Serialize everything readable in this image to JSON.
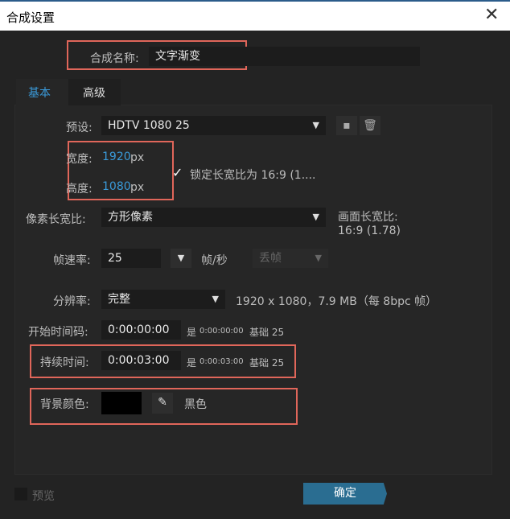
{
  "window": {
    "title": "合成设置",
    "close_icon": "close-icon"
  },
  "comp_name": {
    "label": "合成名称:",
    "value": "文字渐变"
  },
  "tabs": [
    {
      "label": "基本",
      "active": true
    },
    {
      "label": "高级",
      "active": false
    }
  ],
  "preset": {
    "label": "预设:",
    "value": "HDTV 1080 25"
  },
  "width": {
    "label": "宽度:",
    "value": "1920",
    "unit": "px"
  },
  "height": {
    "label": "高度:",
    "value": "1080",
    "unit": "px"
  },
  "lock_aspect": {
    "label": "锁定长宽比为 16:9 (1....",
    "checked": true
  },
  "pixel_aspect": {
    "label": "像素长宽比:",
    "value": "方形像素",
    "frame_aspect_label": "画面长宽比:",
    "frame_aspect_value": "16:9 (1.78)"
  },
  "frame_rate": {
    "label": "帧速率:",
    "value": "25",
    "unit": "帧/秒",
    "drop_frame": "丢帧"
  },
  "resolution": {
    "label": "分辨率:",
    "value": "完整",
    "info": "1920 x 1080，7.9 MB（每 8bpc 帧）"
  },
  "start_timecode": {
    "label": "开始时间码:",
    "value": "0:00:00:00",
    "is": "是",
    "is_value": "0:00:00:00",
    "base": "基础 25"
  },
  "duration": {
    "label": "持续时间:",
    "value": "0:00:03:00",
    "is": "是",
    "is_value": "0:00:03:00",
    "base": "基础 25"
  },
  "bg_color": {
    "label": "背景颜色:",
    "color": "#000000",
    "name": "黑色"
  },
  "footer": {
    "preview_label": "预览",
    "ok_label": "确定"
  },
  "colors": {
    "accent": "#3a9ad9",
    "button": "#2a6d91",
    "highlight": "#e0665a"
  }
}
